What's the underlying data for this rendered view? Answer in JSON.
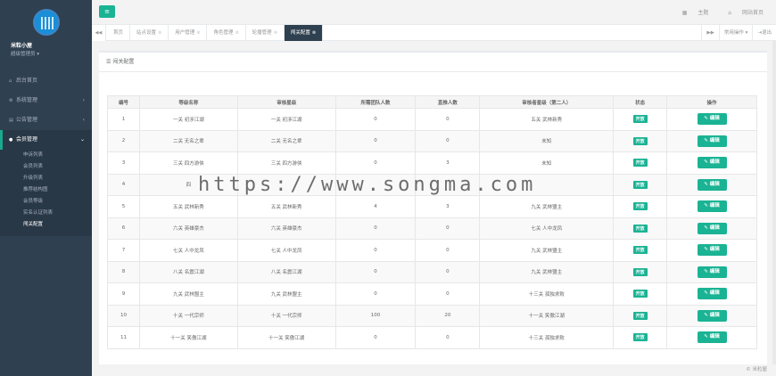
{
  "profile": {
    "name": "米粒小屋",
    "role": "超级管理员"
  },
  "nav": [
    {
      "label": "后台首页",
      "icon": "home-icon",
      "has_arrow": false,
      "active": false
    },
    {
      "label": "系统管理",
      "icon": "gear-icon",
      "has_arrow": true,
      "active": false
    },
    {
      "label": "公告管理",
      "icon": "list-icon",
      "has_arrow": true,
      "active": false
    },
    {
      "label": "会员管理",
      "icon": "user-icon",
      "has_arrow": true,
      "active": true
    }
  ],
  "sub_nav": [
    "申诉列表",
    "会员列表",
    "升级列表",
    "推荐结构图",
    "会员等级",
    "实名认证列表",
    "闯关配置"
  ],
  "topbar": {
    "theme": "主题",
    "site_home": "网站首页"
  },
  "tabs": [
    {
      "label": "首页",
      "active": false
    },
    {
      "label": "站点设置",
      "active": false
    },
    {
      "label": "用户管理",
      "active": false
    },
    {
      "label": "角色管理",
      "active": false
    },
    {
      "label": "轮播管理",
      "active": false
    },
    {
      "label": "闯关配置",
      "active": true
    }
  ],
  "tabs_right": {
    "ops": "常用操作",
    "logout": "退出"
  },
  "panel_title": "闯关配置",
  "table": {
    "headers": [
      "编号",
      "等级名称",
      "审核星级",
      "所需团队人数",
      "直推人数",
      "审核者星级（第二人）",
      "状态",
      "操作"
    ],
    "rows": [
      [
        "1",
        "一关 初涉江湖",
        "一关 初涉江湖",
        "0",
        "0",
        "五关 武林新秀",
        "开放",
        "编辑"
      ],
      [
        "2",
        "二关 无名之辈",
        "二关 无名之辈",
        "0",
        "0",
        "未知",
        "开放",
        "编辑"
      ],
      [
        "3",
        "三关 四方游侠",
        "三关 四方游侠",
        "0",
        "3",
        "未知",
        "开放",
        "编辑"
      ],
      [
        "4",
        "四",
        "",
        "",
        "",
        "",
        "开放",
        "编辑"
      ],
      [
        "5",
        "五关 武林新秀",
        "五关 武林新秀",
        "4",
        "3",
        "九关 武林盟主",
        "开放",
        "编辑"
      ],
      [
        "6",
        "六关 英雄豪杰",
        "六关 英雄豪杰",
        "0",
        "0",
        "七关 人中龙凤",
        "开放",
        "编辑"
      ],
      [
        "7",
        "七关 人中龙凤",
        "七关 人中龙凤",
        "0",
        "0",
        "九关 武林盟主",
        "开放",
        "编辑"
      ],
      [
        "8",
        "八关 名震江湖",
        "八关 名震江湖",
        "0",
        "0",
        "九关 武林盟主",
        "开放",
        "编辑"
      ],
      [
        "9",
        "九关 武林盟主",
        "九关 武林盟主",
        "0",
        "0",
        "十三关 孤独求败",
        "开放",
        "编辑"
      ],
      [
        "10",
        "十关 一代宗师",
        "十关 一代宗师",
        "100",
        "20",
        "十一关 笑傲江湖",
        "开放",
        "编辑"
      ],
      [
        "11",
        "十一关 笑傲江湖",
        "十一关 笑傲江湖",
        "0",
        "0",
        "十三关 孤独求败",
        "开放",
        "编辑"
      ]
    ]
  },
  "footer": "© 米粒屋",
  "watermark": "https://www.songma.com"
}
